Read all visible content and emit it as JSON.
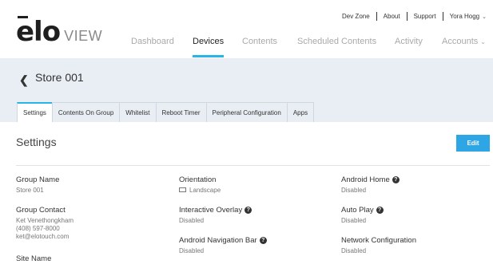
{
  "brand": {
    "logo_main": "elo",
    "logo_sub": "VIEW"
  },
  "util_links": [
    {
      "label": "Dev Zone"
    },
    {
      "label": "About"
    },
    {
      "label": "Support"
    },
    {
      "label": "Yora Hogg"
    }
  ],
  "nav": [
    {
      "label": "Dashboard",
      "active": false
    },
    {
      "label": "Devices",
      "active": true
    },
    {
      "label": "Contents",
      "active": false
    },
    {
      "label": "Scheduled Contents",
      "active": false
    },
    {
      "label": "Activity",
      "active": false
    },
    {
      "label": "Accounts",
      "active": false
    }
  ],
  "page": {
    "title": "Store 001"
  },
  "tabs": [
    {
      "label": "Settings",
      "active": true
    },
    {
      "label": "Contents On Group",
      "active": false
    },
    {
      "label": "Whitelist",
      "active": false
    },
    {
      "label": "Reboot Timer",
      "active": false
    },
    {
      "label": "Peripheral Configuration",
      "active": false
    },
    {
      "label": "Apps",
      "active": false
    }
  ],
  "section": {
    "title": "Settings",
    "edit_label": "Edit"
  },
  "fields": {
    "group_name": {
      "label": "Group Name",
      "value": "Store 001"
    },
    "group_contact": {
      "label": "Group Contact",
      "line1": "Ket Venethongkham",
      "line2": "(408) 597-8000",
      "line3": "ket@elotouch.com"
    },
    "site_name": {
      "label": "Site Name"
    },
    "orientation": {
      "label": "Orientation",
      "value": "Landscape"
    },
    "interactive_overlay": {
      "label": "Interactive Overlay",
      "value": "Disabled"
    },
    "android_nav_bar": {
      "label": "Android Navigation Bar",
      "value": "Disabled"
    },
    "android_home": {
      "label": "Android Home",
      "value": "Disabled"
    },
    "auto_play": {
      "label": "Auto Play",
      "value": "Disabled"
    },
    "network_config": {
      "label": "Network Configuration",
      "value": "Disabled"
    }
  },
  "colors": {
    "accent": "#28b4e6",
    "band": "#e8eef3",
    "button": "#2ea6e6"
  }
}
